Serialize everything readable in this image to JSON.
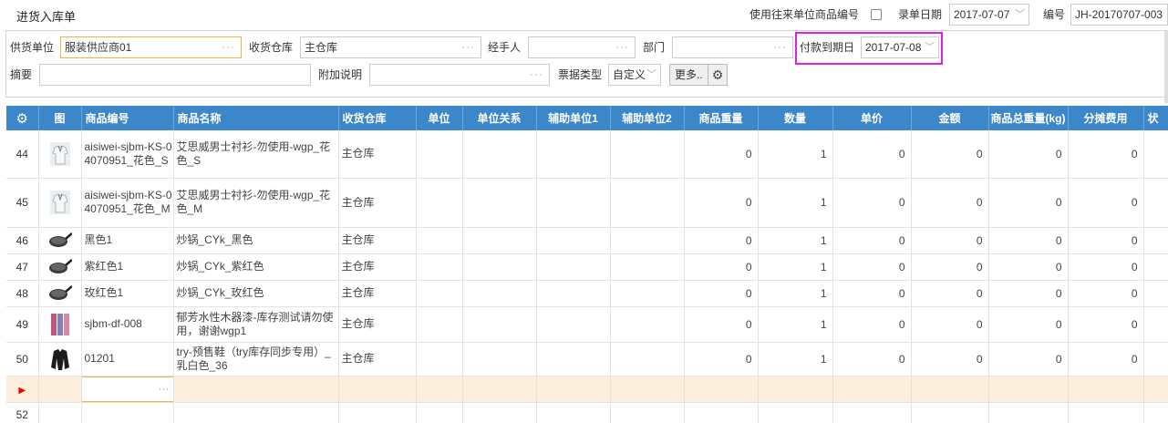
{
  "page": {
    "title": "进货入库单"
  },
  "top_bar": {
    "use_partner_code_label": "使用往来单位商品编号",
    "record_date_label": "录单日期",
    "record_date_value": "2017-07-07",
    "number_label": "编号",
    "number_value": "JH-20170707-003"
  },
  "form": {
    "supplier_label": "供货单位",
    "supplier_value": "服装供应商01",
    "warehouse_label": "收货仓库",
    "warehouse_value": "主仓库",
    "handler_label": "经手人",
    "handler_value": "",
    "dept_label": "部门",
    "dept_value": "",
    "due_date_label": "付款到期日",
    "due_date_value": "2017-07-08",
    "summary_label": "摘要",
    "summary_value": "",
    "extra_label": "附加说明",
    "extra_value": "",
    "bill_type_label": "票据类型",
    "bill_type_value": "自定义",
    "more_label": "更多.."
  },
  "grid": {
    "headers": [
      "",
      "图",
      "商品编号",
      "商品名称",
      "收货仓库",
      "单位",
      "单位关系",
      "辅助单位1",
      "辅助单位2",
      "商品重量",
      "数量",
      "单价",
      "金额",
      "商品总重量(kg)",
      "分摊费用",
      "状"
    ],
    "rows": [
      {
        "no": "44",
        "img": "shirt",
        "code": "aisiwei-sjbm-KS-04070951_花色_S",
        "name": "艾思威男士衬衫-勿使用-wgp_花色_S",
        "wh": "主仓库",
        "weight": "0",
        "qty": "1",
        "price": "0",
        "amount": "0",
        "total_weight": "0",
        "fee": "0"
      },
      {
        "no": "45",
        "img": "shirt",
        "code": "aisiwei-sjbm-KS-04070951_花色_M",
        "name": "艾思威男士衬衫-勿使用-wgp_花色_M",
        "wh": "主仓库",
        "weight": "0",
        "qty": "1",
        "price": "0",
        "amount": "0",
        "total_weight": "0",
        "fee": "0"
      },
      {
        "no": "46",
        "img": "pan",
        "code": "黑色1",
        "name": "炒锅_CYk_黑色",
        "wh": "主仓库",
        "weight": "0",
        "qty": "1",
        "price": "0",
        "amount": "0",
        "total_weight": "0",
        "fee": "0"
      },
      {
        "no": "47",
        "img": "pan",
        "code": "紫红色1",
        "name": "炒锅_CYk_紫红色",
        "wh": "主仓库",
        "weight": "0",
        "qty": "1",
        "price": "0",
        "amount": "0",
        "total_weight": "0",
        "fee": "0"
      },
      {
        "no": "48",
        "img": "pan",
        "code": "玫红色1",
        "name": "炒锅_CYk_玫红色",
        "wh": "主仓库",
        "weight": "0",
        "qty": "1",
        "price": "0",
        "amount": "0",
        "total_weight": "0",
        "fee": "0"
      },
      {
        "no": "49",
        "img": "paint",
        "code": "sjbm-df-008",
        "name": "郁芳水性木器漆-库存测试请勿使用，谢谢wgp1",
        "wh": "主仓库",
        "weight": "0",
        "qty": "1",
        "price": "0",
        "amount": "0",
        "total_weight": "0",
        "fee": "0"
      },
      {
        "no": "50",
        "img": "jacket",
        "code": "01201",
        "name": "try-预售鞋（try库存同步专用）_乳白色_36",
        "wh": "主仓库",
        "weight": "0",
        "qty": "1",
        "price": "0",
        "amount": "0",
        "total_weight": "0",
        "fee": "0"
      }
    ],
    "next_row_no": "52"
  },
  "colors": {
    "header_bg": "#3c87c9",
    "highlight": "#e31ee3",
    "current_row": "#fcf0dc"
  }
}
